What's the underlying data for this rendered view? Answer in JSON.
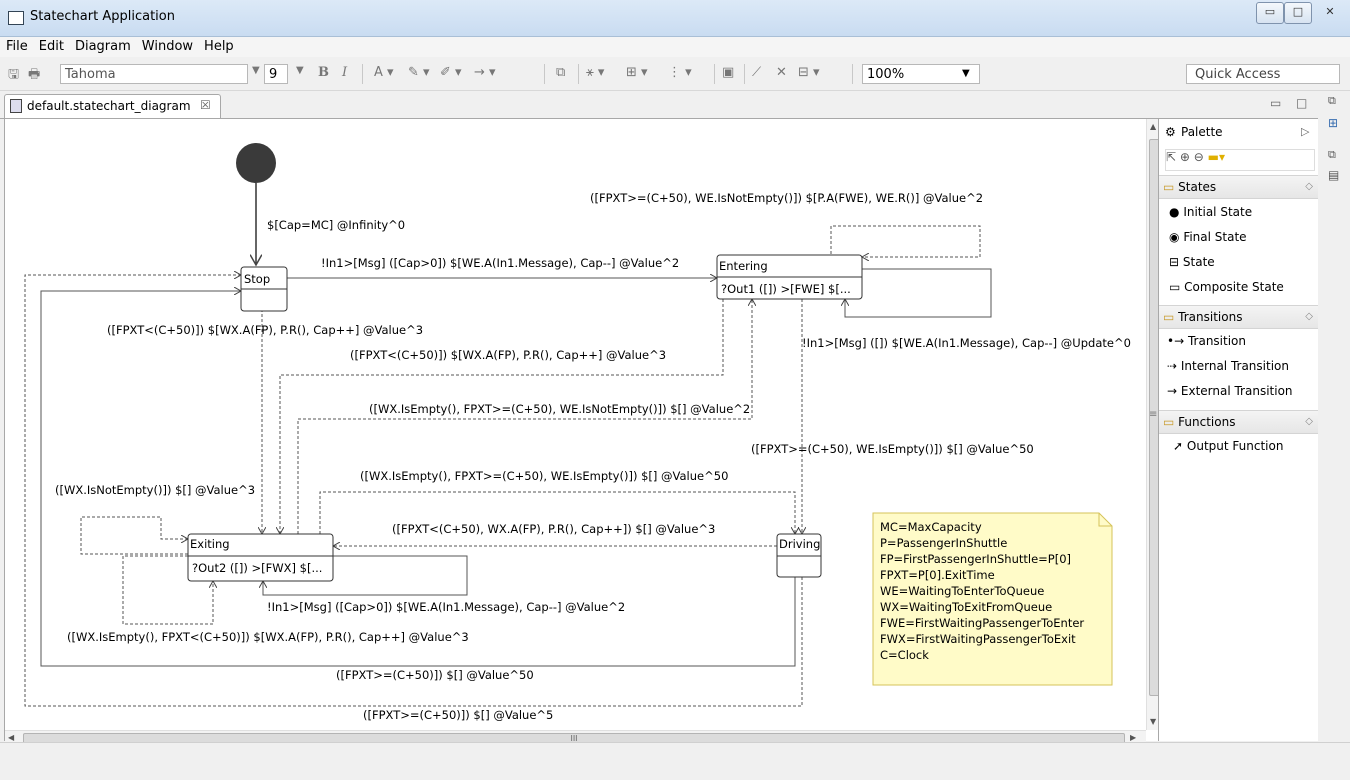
{
  "window": {
    "title": "Statechart Application",
    "min_glyph": "▭",
    "max_glyph": "□",
    "close_glyph": "✕"
  },
  "menu": [
    "File",
    "Edit",
    "Diagram",
    "Window",
    "Help"
  ],
  "toolbar": {
    "font_name": "Tahoma",
    "font_size": "9",
    "bold": "B",
    "italic": "I",
    "zoom": "100%",
    "quick_access": "Quick Access"
  },
  "tab": {
    "label": "default.statechart_diagram",
    "close": "☒"
  },
  "palette": {
    "title": "Palette",
    "groups": [
      {
        "label": "States",
        "items": [
          "Initial State",
          "Final State",
          "State",
          "Composite State"
        ]
      },
      {
        "label": "Transitions",
        "items": [
          "Transition",
          "Internal Transition",
          "External Transition"
        ]
      },
      {
        "label": "Functions",
        "items": [
          "Output Function"
        ]
      }
    ]
  },
  "scroll": {
    "h_grip": "III"
  },
  "diagram": {
    "states": {
      "stop": {
        "name": "Stop",
        "body": ""
      },
      "entering": {
        "name": "Entering",
        "body": "?Out1 ([]) >[FWE] $[..."
      },
      "exiting": {
        "name": "Exiting",
        "body": "?Out2 ([]) >[FWX] $[..."
      },
      "driving": {
        "name": "Driving",
        "body": ""
      }
    },
    "labels": {
      "init": "$[Cap=MC] @Infinity^0",
      "stop_to_entering": "!In1>[Msg] ([Cap>0]) $[WE.A(In1.Message), Cap--] @Value^2",
      "entering_self_top": "([FPXT>=(C+50), WE.IsNotEmpty()]) $[P.A(FWE), WE.R()] @Value^2",
      "stop_down": "([FPXT<(C+50)]) $[WX.A(FP), P.R(), Cap++] @Value^3",
      "entering_to_exiting": "([FPXT<(C+50)]) $[WX.A(FP), P.R(), Cap++] @Value^3",
      "entering_update": "!In1>[Msg] ([]) $[WE.A(In1.Message), Cap--] @Update^0",
      "exiting_to_entering": "([WX.IsEmpty(), FPXT>=(C+50), WE.IsNotEmpty()]) $[] @Value^2",
      "entering_to_driving": "([FPXT>=(C+50), WE.IsEmpty()]) $[] @Value^50",
      "exiting_to_driving": "([WX.IsEmpty(), FPXT>=(C+50), WE.IsEmpty()]) $[] @Value^50",
      "exiting_self_left": "([WX.IsNotEmpty()]) $[] @Value^3",
      "driving_to_exiting": "([FPXT<(C+50), WX.A(FP), P.R(), Cap++]) $[] @Value^3",
      "exiting_msg": "!In1>[Msg] ([Cap>0]) $[WE.A(In1.Message), Cap--] @Value^2",
      "exiting_self_bottom": "([WX.IsEmpty(), FPXT<(C+50)]) $[WX.A(FP), P.R(), Cap++] @Value^3",
      "driving_to_stop_1": "([FPXT>=(C+50)]) $[] @Value^50",
      "driving_to_stop_2": "([FPXT>=(C+50)]) $[] @Value^5"
    },
    "note": [
      "MC=MaxCapacity",
      "P=PassengerInShuttle",
      "FP=FirstPassengerInShuttle=P[0]",
      "FPXT=P[0].ExitTime",
      "WE=WaitingToEnterToQueue",
      "WX=WaitingToExitFromQueue",
      "FWE=FirstWaitingPassengerToEnter",
      "FWX=FirstWaitingPassengerToExit",
      "C=Clock"
    ]
  },
  "colors": {
    "note_bg": "#fffbc8",
    "note_border": "#d6c35a",
    "line": "#555555"
  }
}
